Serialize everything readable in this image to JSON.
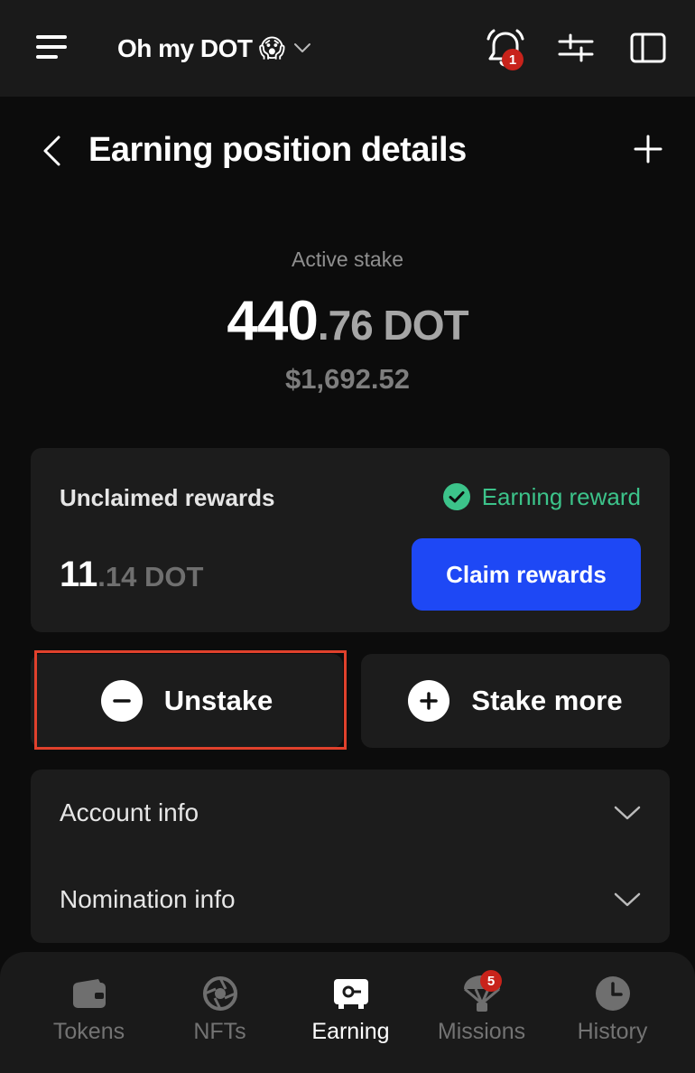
{
  "topbar": {
    "account_name": "Oh my DOT 😱",
    "notification_count": "1",
    "icons": [
      "menu-icon",
      "chevron-down-icon",
      "bell-icon",
      "sliders-icon",
      "sidebar-panel-icon"
    ]
  },
  "header": {
    "title": "Earning position details",
    "icons": [
      "back-icon",
      "plus-icon"
    ]
  },
  "stake": {
    "label": "Active stake",
    "amount_int": "440",
    "amount_dec": ".76 DOT",
    "usd_value": "$1,692.52"
  },
  "rewards": {
    "label": "Unclaimed rewards",
    "status": "Earning reward",
    "amount_int": "11",
    "amount_dec": ".14 DOT",
    "claim_label": "Claim rewards"
  },
  "actions": {
    "unstake_label": "Unstake",
    "stake_more_label": "Stake more"
  },
  "info": {
    "account_info_label": "Account info",
    "nomination_info_label": "Nomination info"
  },
  "nav": {
    "tokens": "Tokens",
    "nfts": "NFTs",
    "earning": "Earning",
    "missions": "Missions",
    "history": "History",
    "missions_badge": "5",
    "active": "Earning"
  },
  "colors": {
    "accent": "#1e48f5",
    "success": "#3cc38a",
    "badge": "#c8231b",
    "highlight": "#e0412c",
    "background": "#0c0c0c",
    "surface": "#1c1c1c"
  }
}
